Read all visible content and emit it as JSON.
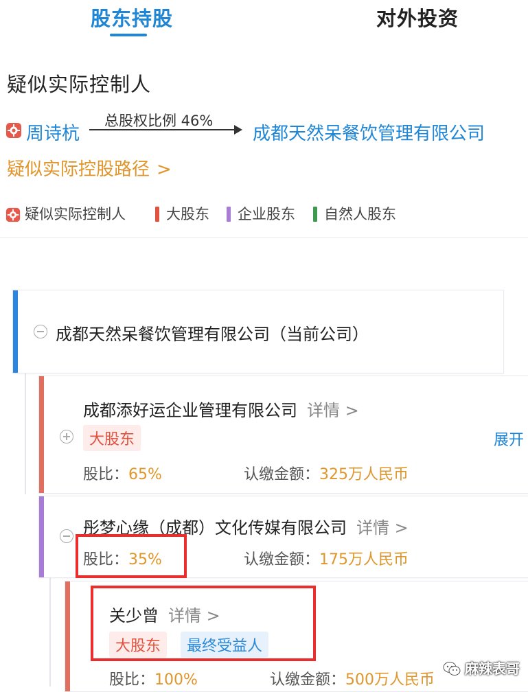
{
  "tabs": {
    "active": "股东持股",
    "inactive": "对外投资"
  },
  "controller": {
    "section_title": "疑似实际控制人",
    "person_name": "周诗杭",
    "ratio_label": "总股权比例 46%",
    "target_company": "成都天然呆餐饮管理有限公司",
    "path_link": "疑似实际控股路径",
    "path_chevron": ">"
  },
  "legend": {
    "items": [
      {
        "label": "疑似实际控制人",
        "icon": "controller-icon"
      },
      {
        "label": "大股东",
        "color": "#e2523f"
      },
      {
        "label": "企业股东",
        "color": "#a77bd6"
      },
      {
        "label": "自然人股东",
        "color": "#3e9a4f"
      }
    ]
  },
  "tree": {
    "root": {
      "name": "成都天然呆餐饮管理有限公司（当前公司）",
      "color": "#2a86de"
    },
    "shareholder1": {
      "name": "成都添好运企业管理有限公司",
      "detail": "详情 >",
      "tag": "大股东",
      "ratio_label": "股比：",
      "ratio_value": "65%",
      "amount_label": "认缴金额：",
      "amount_value": "325万人民币",
      "expand": "展开",
      "color": "#e06f5f"
    },
    "shareholder2": {
      "name": "彤梦心缘（成都）文化传媒有限公司",
      "detail": "详情 >",
      "ratio_label": "股比：",
      "ratio_value": "35%",
      "amount_label": "认缴金额：",
      "amount_value": "175万人民币",
      "color": "#a77bd6"
    },
    "shareholder3": {
      "name": "关少曾",
      "detail": "详情 >",
      "tag1": "大股东",
      "tag2": "最终受益人",
      "ratio_label": "股比：",
      "ratio_value": "100%",
      "amount_label": "认缴金额：",
      "amount_value": "500万人民币",
      "color": "#e06f5f"
    }
  },
  "watermark": "麻辣表哥"
}
